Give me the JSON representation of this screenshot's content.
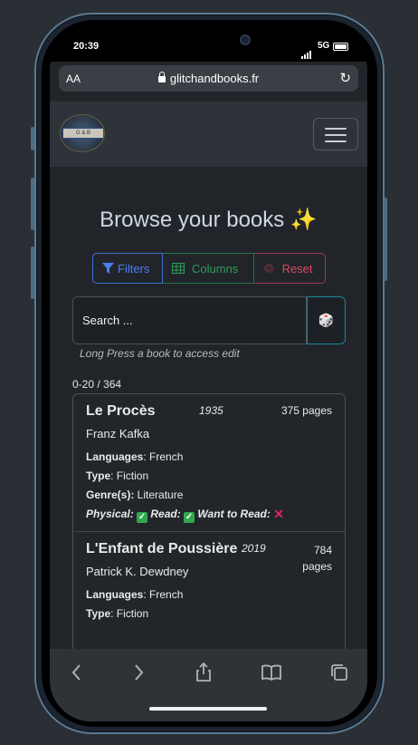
{
  "status": {
    "time": "20:39",
    "network": "5G"
  },
  "browser": {
    "aa_label": "AA",
    "url": "glitchandbooks.fr"
  },
  "navbar": {
    "logo_text": "G & B"
  },
  "page": {
    "title": "Browse your books ✨",
    "filters_label": "Filters",
    "columns_label": "Columns",
    "reset_label": "Reset",
    "search_placeholder": "Search ...",
    "dice_icon": "🎲",
    "hint": "Long Press a book to access edit",
    "count": "0-20 / 364"
  },
  "books": [
    {
      "title": "Le Procès",
      "year": "1935",
      "pages": "375 pages",
      "author": "Franz Kafka",
      "languages_label": "Languages",
      "languages": " French",
      "type_label": "Type",
      "type": " Fiction",
      "genre_label": "Genre(s):",
      "genre": " Literature",
      "physical_label": "Physical:",
      "read_label": "Read",
      "want_label": "Want to Read",
      "physical": true,
      "read": true,
      "want_to_read": false
    },
    {
      "title": "L'Enfant de Poussière",
      "year": "2019",
      "pages": "784 pages",
      "author": "Patrick K. Dewdney",
      "languages_label": "Languages",
      "languages": " French",
      "type_label": "Type",
      "type": " Fiction"
    }
  ],
  "colors": {
    "accent_primary": "#4a7ef0",
    "accent_success": "#2f9b5a",
    "accent_danger": "#d9485e",
    "accent_info": "#19889a"
  }
}
